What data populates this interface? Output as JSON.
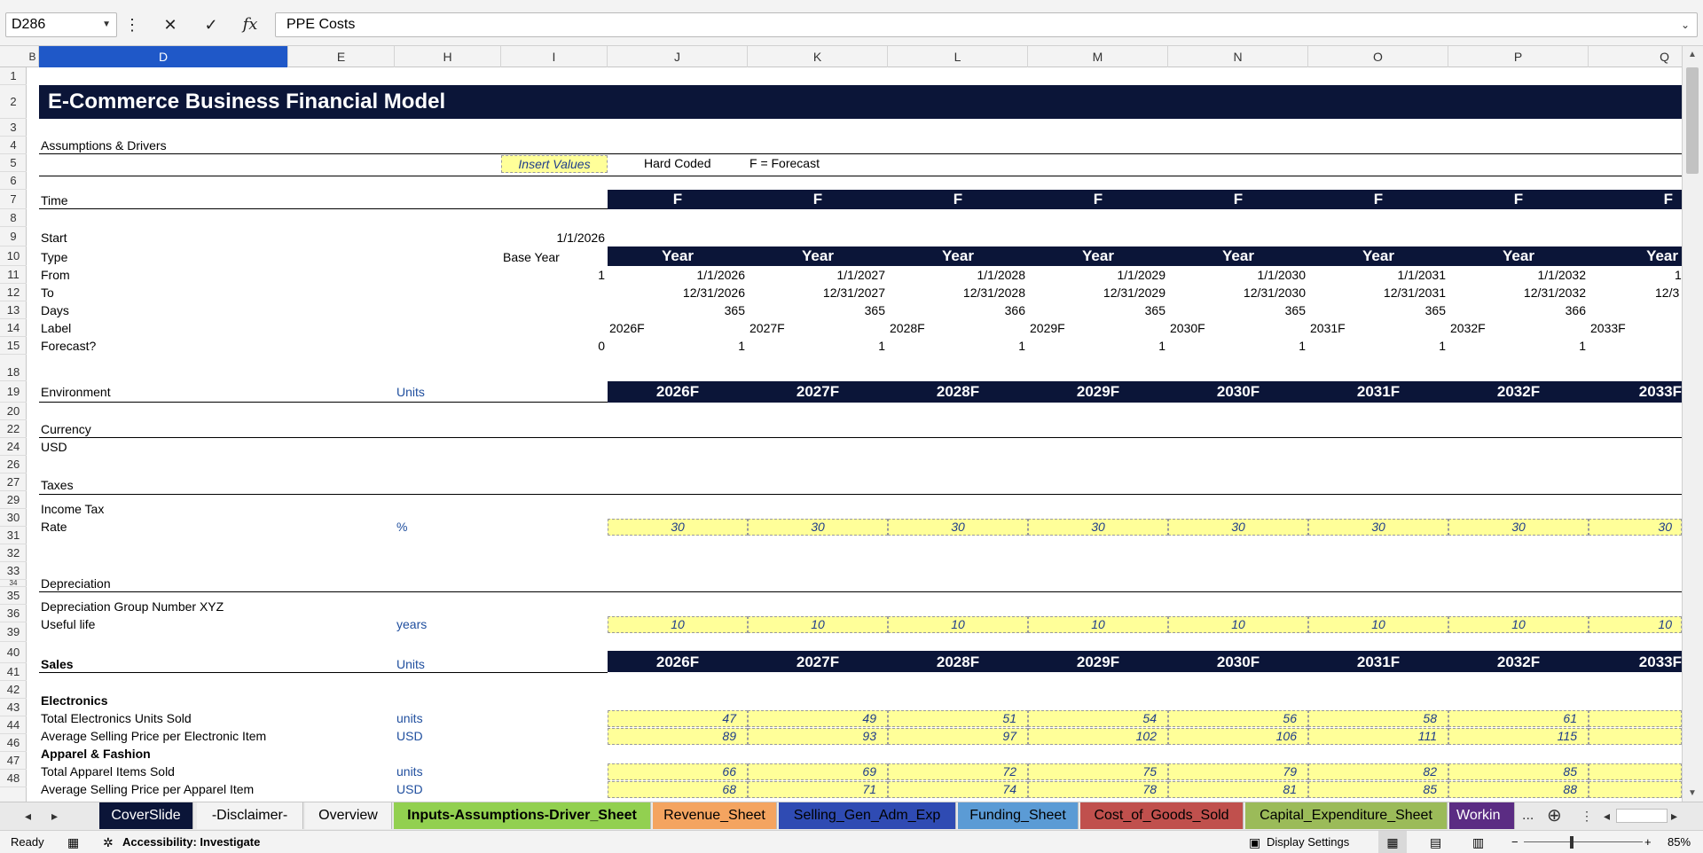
{
  "formula_bar": {
    "name_box": "D286",
    "cancel_icon": "✕",
    "enter_icon": "✓",
    "function_icon": "fx",
    "formula": "PPE Costs"
  },
  "columns": [
    {
      "label": "B"
    },
    {
      "label": "D"
    },
    {
      "label": "E"
    },
    {
      "label": "H"
    },
    {
      "label": "I"
    },
    {
      "label": "J"
    },
    {
      "label": "K"
    },
    {
      "label": "L"
    },
    {
      "label": "M"
    },
    {
      "label": "N"
    },
    {
      "label": "O"
    },
    {
      "label": "P"
    },
    {
      "label": "Q"
    }
  ],
  "rows": [
    "1",
    "2",
    "3",
    "4",
    "5",
    "6",
    "7",
    "8",
    "9",
    "10",
    "11",
    "12",
    "13",
    "14",
    "15",
    "18",
    "19",
    "20",
    "22",
    "24",
    "26",
    "27",
    "29",
    "30",
    "31",
    "32",
    "33",
    "34",
    "35",
    "36",
    "39",
    "40",
    "41",
    "42",
    "43",
    "44",
    "46",
    "47",
    "48"
  ],
  "sheet": {
    "title": "E-Commerce Business Financial Model",
    "section_assumptions": "Assumptions & Drivers",
    "legend_insert": "Insert Values",
    "legend_hard": "Hard Coded",
    "legend_forecast": "F = Forecast",
    "time_label": "Time",
    "flag": "F",
    "start_label": "Start",
    "start_value": "1/1/2026",
    "type_label": "Type",
    "base_year": "Base Year",
    "year_word": "Year",
    "from_label": "From",
    "to_label": "To",
    "days_label": "Days",
    "label_label": "Label",
    "forecast_label": "Forecast?",
    "from_base": "1",
    "forecast_base": "0",
    "environment_label": "Environment",
    "units_label": "Units",
    "currency_label": "Currency",
    "currency_value": "USD",
    "taxes_label": "Taxes",
    "income_tax_label": "Income Tax",
    "rate_label": "Rate",
    "rate_unit": "%",
    "depreciation_label": "Depreciation",
    "dep_group_label": "Depreciation Group Number XYZ",
    "useful_life_label": "Useful life",
    "useful_life_unit": "years",
    "sales_label": "Sales",
    "electronics_label": "Electronics",
    "elec_units_label": "Total Electronics Units Sold",
    "elec_units_unit": "units",
    "elec_price_label": "Average Selling Price per Electronic Item",
    "elec_price_unit": "USD",
    "apparel_label": "Apparel & Fashion",
    "app_units_label": "Total Apparel Items Sold",
    "app_units_unit": "units",
    "app_price_label": "Average Selling Price per Apparel Item",
    "app_price_unit": "USD"
  },
  "periods": [
    {
      "from": "1/1/2026",
      "to": "12/31/2026",
      "days": "365",
      "label": "2026F",
      "forecast": "1",
      "header": "2026F",
      "rate": "30",
      "life": "10",
      "elec_units": "47",
      "elec_price": "89",
      "app_units": "66",
      "app_price": "68"
    },
    {
      "from": "1/1/2027",
      "to": "12/31/2027",
      "days": "365",
      "label": "2027F",
      "forecast": "1",
      "header": "2027F",
      "rate": "30",
      "life": "10",
      "elec_units": "49",
      "elec_price": "93",
      "app_units": "69",
      "app_price": "71"
    },
    {
      "from": "1/1/2028",
      "to": "12/31/2028",
      "days": "366",
      "label": "2028F",
      "forecast": "1",
      "header": "2028F",
      "rate": "30",
      "life": "10",
      "elec_units": "51",
      "elec_price": "97",
      "app_units": "72",
      "app_price": "74"
    },
    {
      "from": "1/1/2029",
      "to": "12/31/2029",
      "days": "365",
      "label": "2029F",
      "forecast": "1",
      "header": "2029F",
      "rate": "30",
      "life": "10",
      "elec_units": "54",
      "elec_price": "102",
      "app_units": "75",
      "app_price": "78"
    },
    {
      "from": "1/1/2030",
      "to": "12/31/2030",
      "days": "365",
      "label": "2030F",
      "forecast": "1",
      "header": "2030F",
      "rate": "30",
      "life": "10",
      "elec_units": "56",
      "elec_price": "106",
      "app_units": "79",
      "app_price": "81"
    },
    {
      "from": "1/1/2031",
      "to": "12/31/2031",
      "days": "365",
      "label": "2031F",
      "forecast": "1",
      "header": "2031F",
      "rate": "30",
      "life": "10",
      "elec_units": "58",
      "elec_price": "111",
      "app_units": "82",
      "app_price": "85"
    },
    {
      "from": "1/1/2032",
      "to": "12/31/2032",
      "days": "366",
      "label": "2032F",
      "forecast": "1",
      "header": "2032F",
      "rate": "30",
      "life": "10",
      "elec_units": "61",
      "elec_price": "115",
      "app_units": "85",
      "app_price": "88"
    },
    {
      "from": "1",
      "to": "12/3",
      "days": "",
      "label": "2033F",
      "forecast": "",
      "header": "2033F",
      "rate": "30",
      "life": "10",
      "elec_units": "",
      "elec_price": "",
      "app_units": "",
      "app_price": ""
    }
  ],
  "tabs": [
    {
      "label": "CoverSlide",
      "bg": "#0b1538",
      "fg": "#ffffff"
    },
    {
      "label": "-Disclaimer-",
      "bg": "#f3f3f3",
      "fg": "#000000"
    },
    {
      "label": "Overview",
      "bg": "#f3f3f3",
      "fg": "#000000"
    },
    {
      "label": "Inputs-Assumptions-Driver_Sheet",
      "bg": "#92d050",
      "fg": "#000000"
    },
    {
      "label": "Revenue_Sheet",
      "bg": "#f4a460",
      "fg": "#000000"
    },
    {
      "label": "Selling_Gen_Adm_Exp",
      "bg": "#2f4bb3",
      "fg": "#000000"
    },
    {
      "label": "Funding_Sheet",
      "bg": "#5b9bd5",
      "fg": "#000000"
    },
    {
      "label": "Cost_of_Goods_Sold",
      "bg": "#c0504d",
      "fg": "#000000"
    },
    {
      "label": "Capital_Expenditure_Sheet",
      "bg": "#9bbb59",
      "fg": "#000000"
    },
    {
      "label": "Workin",
      "bg": "#5b2c83",
      "fg": "#ffffff"
    }
  ],
  "tab_more": "...",
  "status": {
    "ready": "Ready",
    "accessibility": "Accessibility: Investigate",
    "display_settings": "Display Settings",
    "zoom": "85%"
  }
}
